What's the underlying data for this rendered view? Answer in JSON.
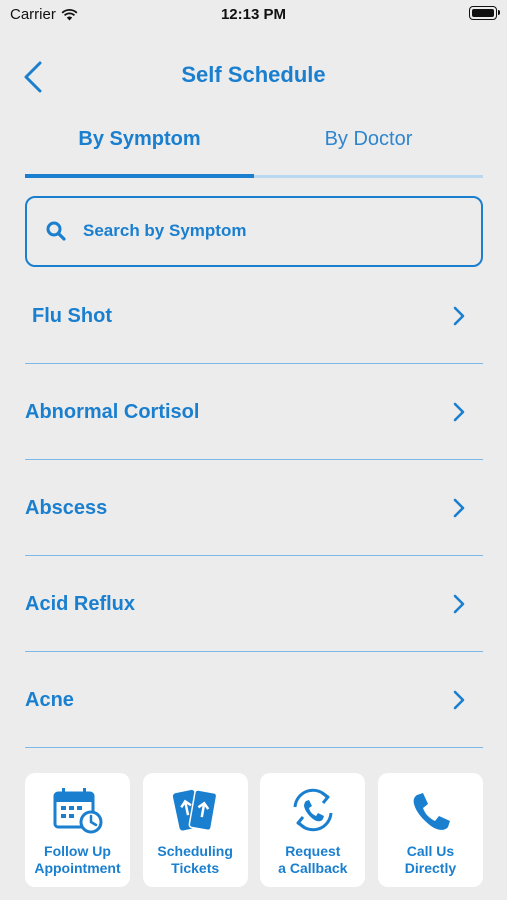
{
  "status_bar": {
    "carrier": "Carrier",
    "time": "12:13 PM"
  },
  "nav": {
    "title": "Self Schedule"
  },
  "tabs": [
    {
      "label": "By Symptom",
      "active": true
    },
    {
      "label": "By Doctor",
      "active": false
    }
  ],
  "search": {
    "placeholder": "Search by Symptom"
  },
  "symptoms": [
    {
      "label": "Flu Shot"
    },
    {
      "label": "Abnormal Cortisol"
    },
    {
      "label": "Abscess"
    },
    {
      "label": "Acid Reflux"
    },
    {
      "label": "Acne"
    }
  ],
  "actions": [
    {
      "line1": "Follow Up",
      "line2": "Appointment",
      "icon": "calendar-clock-icon"
    },
    {
      "line1": "Scheduling",
      "line2": "Tickets",
      "icon": "tickets-icon"
    },
    {
      "line1": "Request",
      "line2": "a Callback",
      "icon": "callback-phone-icon"
    },
    {
      "line1": "Call Us",
      "line2": "Directly",
      "icon": "phone-icon"
    }
  ],
  "colors": {
    "accent": "#1a7fcf",
    "background": "#ececec",
    "divider": "#7eb8e6"
  }
}
